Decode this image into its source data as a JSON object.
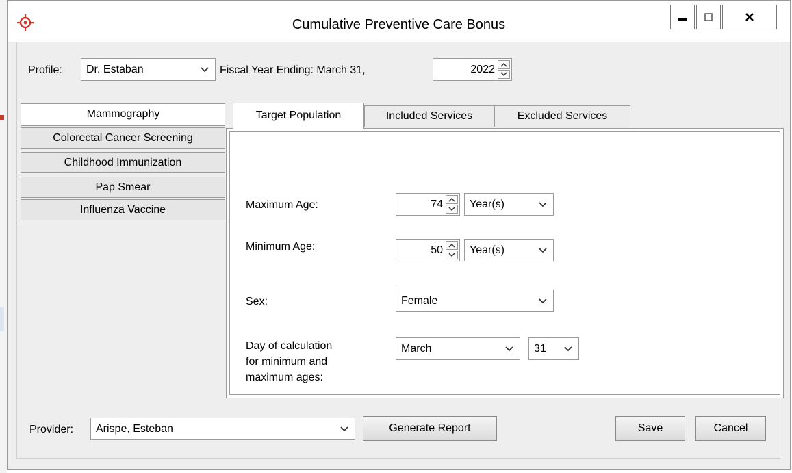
{
  "window": {
    "title": "Cumulative Preventive Care Bonus"
  },
  "header": {
    "profile_label": "Profile:",
    "profile_value": "Dr. Estaban",
    "fiscal_label": "Fiscal Year Ending:  March 31,",
    "fiscal_year": "2022"
  },
  "categories": [
    {
      "label": "Mammography",
      "active": true
    },
    {
      "label": "Colorectal Cancer Screening",
      "active": false
    },
    {
      "label": "Childhood Immunization",
      "active": false
    },
    {
      "label": "Pap Smear",
      "active": false
    },
    {
      "label": "Influenza Vaccine",
      "active": false
    }
  ],
  "tabs": [
    {
      "label": "Target Population",
      "active": true
    },
    {
      "label": "Included Services",
      "active": false
    },
    {
      "label": "Excluded Services",
      "active": false
    }
  ],
  "form": {
    "max_age_label": "Maximum Age:",
    "max_age_value": "74",
    "max_age_unit": "Year(s)",
    "min_age_label": "Minimum Age:",
    "min_age_value": "50",
    "min_age_unit": "Year(s)",
    "sex_label": "Sex:",
    "sex_value": "Female",
    "calc_label_lines": [
      "Day of calculation",
      "for minimum and",
      "maximum ages:"
    ],
    "calc_month": "March",
    "calc_day": "31"
  },
  "footer": {
    "provider_label": "Provider:",
    "provider_value": "Arispe, Esteban",
    "generate_label": "Generate Report",
    "save_label": "Save",
    "cancel_label": "Cancel"
  },
  "colors": {
    "accent_icon": "#d0362a"
  }
}
